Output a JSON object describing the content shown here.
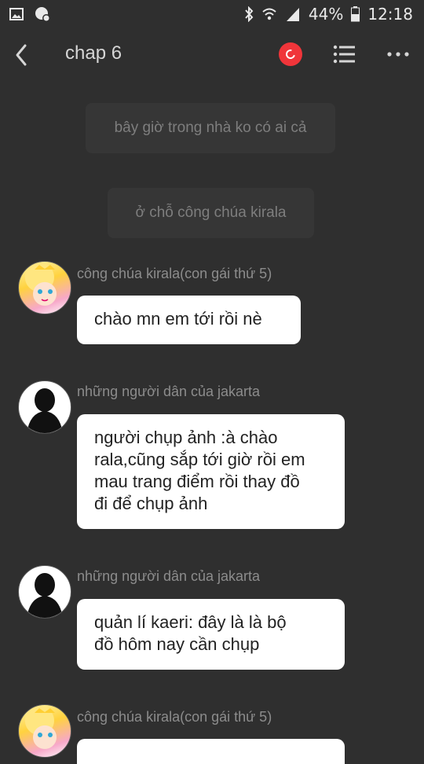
{
  "status_bar": {
    "battery": "44%",
    "time": "12:18"
  },
  "header": {
    "title": "chap 6"
  },
  "narration": [
    "bây giờ trong nhà ko có ai cả",
    "ở chỗ công chúa kirala"
  ],
  "messages": [
    {
      "sender": "công chúa kirala(con gái thứ 5)",
      "avatar": "princess-avatar",
      "text": "chào mn em  tới rồi nè"
    },
    {
      "sender": "những người dân của jakarta",
      "avatar": "silhouette-avatar",
      "text": "người chụp ảnh :à chào\nrala,cũng sắp tới giờ rồi em\nmau trang điểm rồi thay đồ\nđi để chụp ảnh"
    },
    {
      "sender": "những người dân của jakarta",
      "avatar": "silhouette-avatar",
      "text": "quản lí kaeri: đây là là bộ\nđồ hôm nay cần chụp"
    },
    {
      "sender": "công chúa kirala(con gái thứ 5)",
      "avatar": "princess-avatar",
      "text": ""
    }
  ]
}
